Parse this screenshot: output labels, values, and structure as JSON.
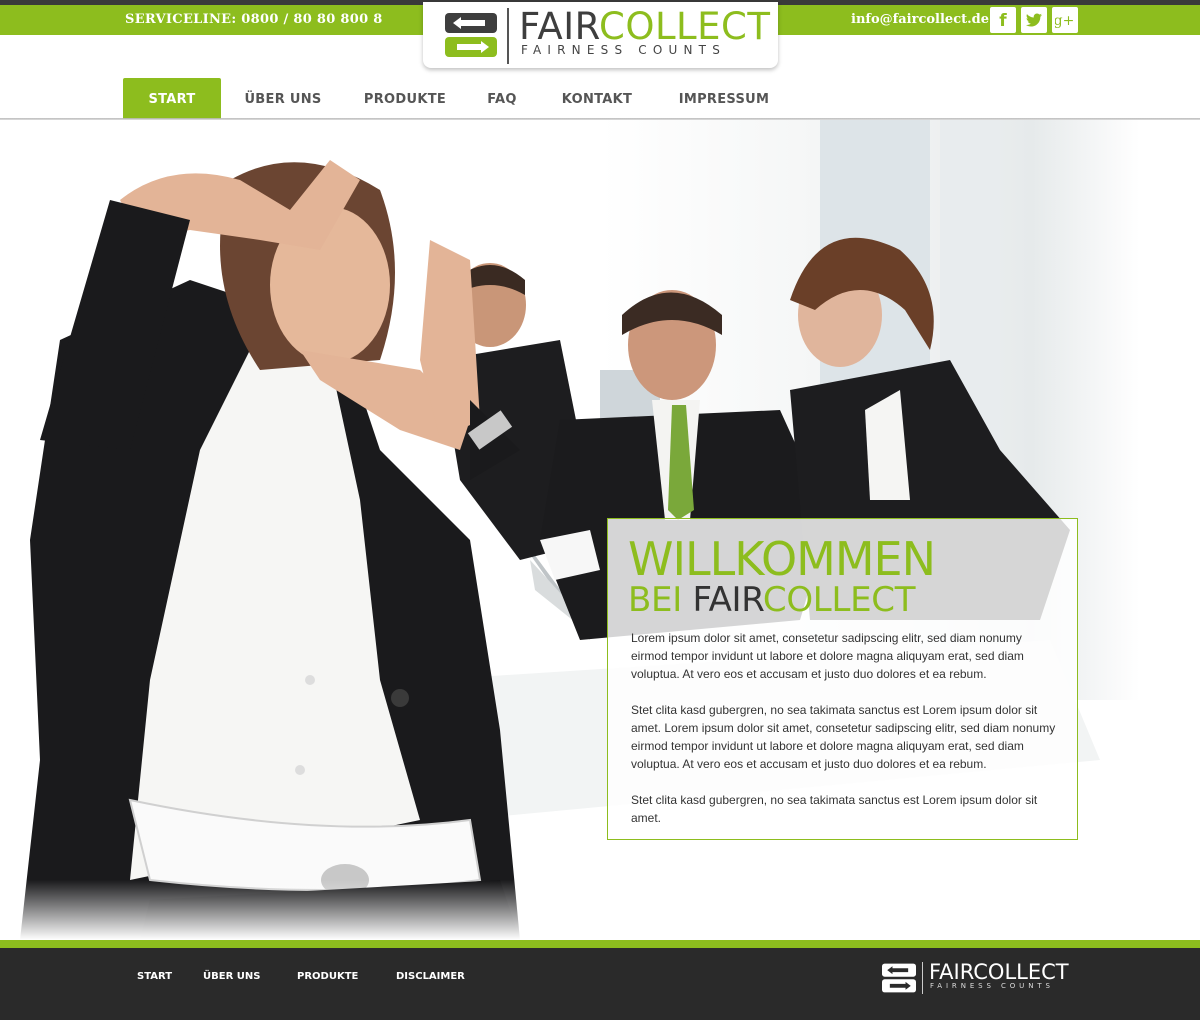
{
  "header": {
    "serviceline": "SERVICELINE: 0800 / 80 80 800 8",
    "email": "info@faircollect.de",
    "social": [
      "facebook-icon",
      "twitter-icon",
      "google-plus-icon"
    ],
    "social_glyphs": {
      "facebook": "f",
      "google_plus": "g+"
    }
  },
  "logo": {
    "word_fair": "FAIR",
    "word_collect": "COLLECT",
    "tagline": "FAIRNESS COUNTS"
  },
  "nav": {
    "items": [
      {
        "label": "START",
        "active": true
      },
      {
        "label": "ÜBER UNS",
        "active": false
      },
      {
        "label": "PRODUKTE",
        "active": false
      },
      {
        "label": "FAQ",
        "active": false
      },
      {
        "label": "KONTAKT",
        "active": false
      },
      {
        "label": "IMPRESSUM",
        "active": false
      }
    ]
  },
  "welcome": {
    "title_line1": "WILLKOMMEN",
    "title_line2_prefix": "BEI ",
    "title_line2_fair": "FAIR",
    "title_line2_collect": "COLLECT",
    "paragraphs": [
      "Lorem ipsum dolor sit amet, consetetur sadipscing elitr, sed diam nonumy eirmod tempor invidunt ut labore et dolore magna aliquyam erat, sed diam voluptua. At vero eos et accusam et justo duo dolores et ea rebum.",
      "Stet clita kasd gubergren, no sea takimata sanctus est Lorem ipsum dolor sit amet. Lorem ipsum dolor sit amet, consetetur sadipscing elitr, sed diam nonumy eirmod tempor invidunt ut labore et dolore magna aliquyam erat, sed diam voluptua. At vero eos et accusam et justo duo dolores et ea rebum.",
      "Stet clita kasd gubergren, no sea takimata sanctus est Lorem ipsum dolor sit amet."
    ]
  },
  "footer": {
    "links": [
      "START",
      "ÜBER UNS",
      "PRODUKTE",
      "DISCLAIMER"
    ],
    "logo_fair": "FAIR",
    "logo_collect": "COLLECT",
    "logo_tagline": "FAIRNESS COUNTS"
  },
  "colors": {
    "brand_green": "#8dbd1e",
    "dark": "#2a2a2a",
    "text": "#333333"
  }
}
